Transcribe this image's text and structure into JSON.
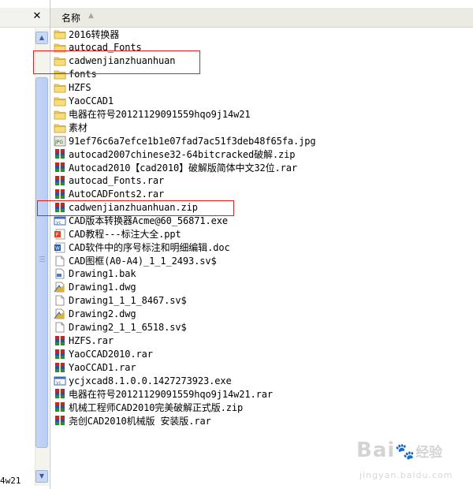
{
  "left_pane": {
    "close_label": "✕",
    "clipped_text": "4w21"
  },
  "header": {
    "column_name": "名称",
    "sort_indicator": "▲"
  },
  "files": [
    {
      "name": "2016转换器",
      "icon": "folder-icon"
    },
    {
      "name": "autocad_Fonts",
      "icon": "folder-icon"
    },
    {
      "name": "cadwenjianzhuanhuan",
      "icon": "folder-icon"
    },
    {
      "name": "fonts",
      "icon": "folder-icon"
    },
    {
      "name": "HZFS",
      "icon": "folder-icon"
    },
    {
      "name": "YaoCCAD1",
      "icon": "folder-icon"
    },
    {
      "name": "电器在符号20121129091559hqo9j14w21",
      "icon": "folder-icon"
    },
    {
      "name": "素材",
      "icon": "folder-icon"
    },
    {
      "name": "91ef76c6a7efce1b1e07fad7ac51f3deb48f65fa.jpg",
      "icon": "jpg-file-icon"
    },
    {
      "name": "autocad2007chinese32-64bitcracked破解.zip",
      "icon": "archive-icon"
    },
    {
      "name": "Autocad2010【cad2010】破解版简体中文32位.rar",
      "icon": "archive-icon"
    },
    {
      "name": "autocad_Fonts.rar",
      "icon": "archive-icon"
    },
    {
      "name": "AutoCADFonts2.rar",
      "icon": "archive-icon"
    },
    {
      "name": "cadwenjianzhuanhuan.zip",
      "icon": "archive-icon"
    },
    {
      "name": "CAD版本转换器Acme@60_56871.exe",
      "icon": "exe-file-icon"
    },
    {
      "name": "CAD教程---标注大全.ppt",
      "icon": "ppt-file-icon"
    },
    {
      "name": "CAD软件中的序号标注和明细编辑.doc",
      "icon": "doc-file-icon"
    },
    {
      "name": "CAD图框(A0-A4)_1_1_2493.sv$",
      "icon": "generic-file-icon"
    },
    {
      "name": "Drawing1.bak",
      "icon": "bak-file-icon"
    },
    {
      "name": "Drawing1.dwg",
      "icon": "dwg-file-icon"
    },
    {
      "name": "Drawing1_1_1_8467.sv$",
      "icon": "generic-file-icon"
    },
    {
      "name": "Drawing2.dwg",
      "icon": "dwg-file-icon"
    },
    {
      "name": "Drawing2_1_1_6518.sv$",
      "icon": "generic-file-icon"
    },
    {
      "name": "HZFS.rar",
      "icon": "archive-icon"
    },
    {
      "name": "YaoCCAD2010.rar",
      "icon": "archive-icon"
    },
    {
      "name": "YaoCCAD1.rar",
      "icon": "archive-icon"
    },
    {
      "name": "ycjxcad8.1.0.0.1427273923.exe",
      "icon": "exe-file-icon"
    },
    {
      "name": "电器在符号20121129091559hqo9j14w21.rar",
      "icon": "archive-icon"
    },
    {
      "name": "机械工程师CAD2010完美破解正式版.zip",
      "icon": "archive-icon"
    },
    {
      "name": "尧创CAD2010机械版 安装版.rar",
      "icon": "archive-icon"
    }
  ],
  "colors": {
    "highlight_box": "#e02020",
    "folder": "#f2cf5b",
    "archive_red": "#c02828",
    "archive_blue": "#2f4fa0"
  },
  "watermark": {
    "logo": "Bai",
    "logo_suffix": "经验",
    "url": "jingyan.baidu.com"
  }
}
